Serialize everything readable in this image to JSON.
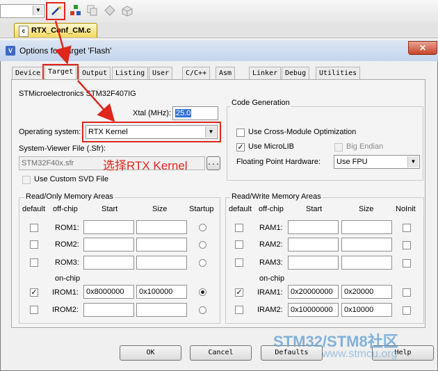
{
  "toolbar": {
    "file_tab": "RTX_Conf_CM.c"
  },
  "dialog": {
    "title": "Options for Target 'Flash'",
    "close": "✕",
    "tabs": [
      "Device",
      "Target",
      "Output",
      "Listing",
      "User",
      "C/C++",
      "Asm",
      "Linker",
      "Debug",
      "Utilities"
    ],
    "active_tab": "Target"
  },
  "target": {
    "device_name": "STMicroelectronics STM32F407IG",
    "xtal_label": "Xtal (MHz):",
    "xtal_value": "25.0",
    "os_label": "Operating system:",
    "os_value": "RTX Kernel",
    "svf_label": "System-Viewer File (.Sfr):",
    "svf_value": "STM32F40x.sfr",
    "svf_browse": "...",
    "custom_svd_label": "Use Custom SVD File",
    "code_gen": {
      "title": "Code Generation",
      "cross_module": "Use Cross-Module Optimization",
      "microlib": "Use MicroLIB",
      "big_endian": "Big Endian",
      "fph_label": "Floating Point Hardware:",
      "fph_value": "Use FPU"
    },
    "ro": {
      "title": "Read/Only Memory Areas",
      "headers": {
        "default": "default",
        "offchip": "off-chip",
        "start": "Start",
        "size": "Size",
        "startup": "Startup"
      },
      "onchip": "on-chip",
      "rows": [
        {
          "name": "ROM1:",
          "start": "",
          "size": "",
          "checked": false,
          "startup": false
        },
        {
          "name": "ROM2:",
          "start": "",
          "size": "",
          "checked": false,
          "startup": false
        },
        {
          "name": "ROM3:",
          "start": "",
          "size": "",
          "checked": false,
          "startup": false
        },
        {
          "name": "IROM1:",
          "start": "0x8000000",
          "size": "0x100000",
          "checked": true,
          "startup": true
        },
        {
          "name": "IROM2:",
          "start": "",
          "size": "",
          "checked": false,
          "startup": false
        }
      ]
    },
    "rw": {
      "title": "Read/Write Memory Areas",
      "headers": {
        "default": "default",
        "offchip": "off-chip",
        "start": "Start",
        "size": "Size",
        "noinit": "NoInit"
      },
      "onchip": "on-chip",
      "rows": [
        {
          "name": "RAM1:",
          "start": "",
          "size": "",
          "checked": false
        },
        {
          "name": "RAM2:",
          "start": "",
          "size": "",
          "checked": false
        },
        {
          "name": "RAM3:",
          "start": "",
          "size": "",
          "checked": false
        },
        {
          "name": "IRAM1:",
          "start": "0x20000000",
          "size": "0x20000",
          "checked": true
        },
        {
          "name": "IRAM2:",
          "start": "0x10000000",
          "size": "0x10000",
          "checked": false
        }
      ]
    }
  },
  "buttons": {
    "ok": "OK",
    "cancel": "Cancel",
    "defaults": "Defaults",
    "help": "Help"
  },
  "annotation": "选择RTX Kernel",
  "watermark": {
    "line1": "STM32/STM8社区",
    "line2": "www.stmcu.org"
  },
  "colors": {
    "annotation_red": "#e0261d",
    "watermark_blue": "#6fa7d6"
  }
}
